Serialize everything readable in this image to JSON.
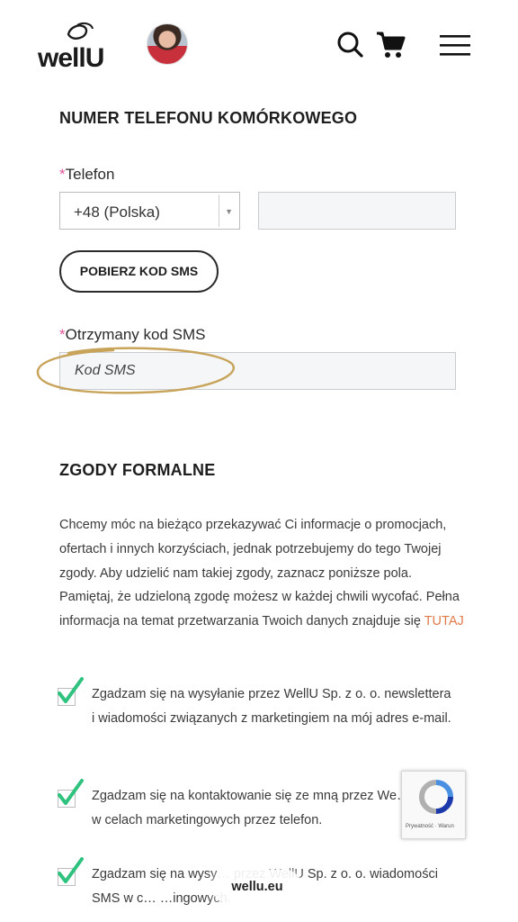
{
  "header": {
    "logo_text": "wellU",
    "icons": [
      "search-icon",
      "cart-icon",
      "hamburger-menu-icon"
    ]
  },
  "phone_section": {
    "heading": "NUMER TELEFONU KOMÓRKOWEGO",
    "phone_label": "Telefon",
    "required_marker": "*",
    "country_select_value": "+48 (Polska)",
    "phone_value": "",
    "get_code_button": "POBIERZ KOD SMS",
    "sms_label": "Otrzymany kod SMS",
    "sms_placeholder": "Kod SMS"
  },
  "consents_section": {
    "heading": "ZGODY FORMALNE",
    "intro": "Chcemy móc na bieżąco przekazywać Ci informacje o promocjach, ofertach i innych korzyściach, jednak potrzebujemy do tego Twojej zgody. Aby udzielić nam takiej zgody, zaznacz poniższe pola. Pamiętaj, że udzieloną zgodę możesz w każdej chwili wycofać. Pełna informacja na temat przetwarzania Twoich danych znajduje się",
    "link_text": "TUTAJ",
    "items": [
      {
        "text": "Zgadzam się na wysyłanie przez WellU Sp. z o. o. newslettera i wiadomości związanych z marketingiem na mój adres e-mail.",
        "checked": true
      },
      {
        "text": "Zgadzam się na kontaktowanie się ze mną przez We… o. o. w celach marketingowych przez telefon.",
        "checked": true
      },
      {
        "text": "Zgadzam się na wysy… przez WellU Sp. z o. o. wiadomości SMS w c… …ingowych.",
        "checked": true
      }
    ]
  },
  "recaptcha": {
    "text": "Prywatność · Warun"
  },
  "browser": {
    "url": "wellu.eu"
  },
  "colors": {
    "required": "#e0559a",
    "link": "#e07a4b",
    "check": "#2ec27e",
    "annotation_circle": "#c8a35a"
  }
}
